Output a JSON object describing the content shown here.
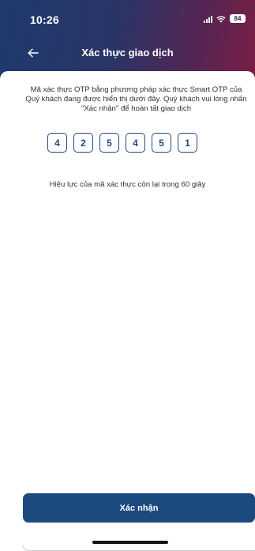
{
  "status_bar": {
    "time": "10:26",
    "battery": "84",
    "icons": [
      "signal-icon",
      "wifi-icon",
      "battery-icon"
    ]
  },
  "nav": {
    "title": "Xác thực giao dịch",
    "back_icon": "arrow-left-icon"
  },
  "message": "Mã xác thực OTP bằng phương pháp xác thực Smart OTP của Quý khách đang được hiển thị dưới đây. Quý khách vui lòng nhấn \"Xác nhận\" để hoàn tất giao dịch",
  "otp_digits": [
    "4",
    "2",
    "5",
    "4",
    "5",
    "1"
  ],
  "validity_text": "Hiệu lực của mã xác thực còn lại trong 60 giây",
  "confirm_label": "Xác nhận",
  "colors": {
    "header_gradient_start": "#1f3a6e",
    "header_gradient_end": "#7a1f45",
    "primary": "#1c4a7e",
    "otp_border": "#1f4a80"
  }
}
